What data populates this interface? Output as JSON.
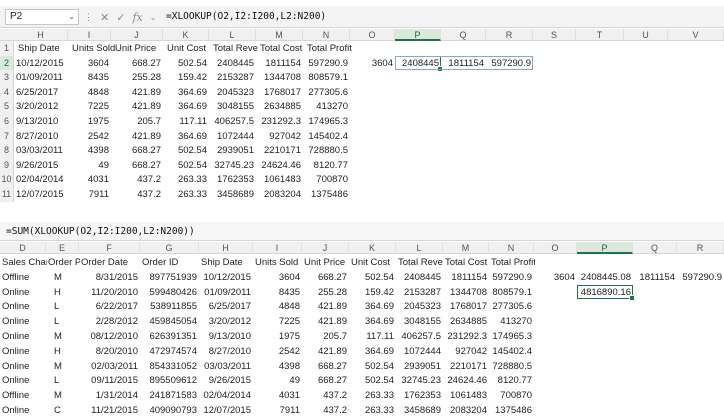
{
  "top": {
    "name_box": "P2",
    "formula": "=XLOOKUP(O2,I2:I200,L2:N200)",
    "columns": [
      "H",
      "I",
      "J",
      "K",
      "L",
      "M",
      "N",
      "O",
      "P",
      "Q",
      "R",
      "S",
      "T",
      "U",
      "V"
    ],
    "selected_column": "P",
    "row_numbers": [
      "1",
      "2",
      "3",
      "4",
      "5",
      "6",
      "7",
      "8",
      "9",
      "10",
      "11"
    ],
    "header_row": [
      "Ship Date",
      "Units Sold",
      "Unit Price",
      "Unit Cost",
      "Total Reve",
      "Total Cost",
      "Total Profit"
    ],
    "rows": [
      [
        "10/12/2015",
        "3604",
        "668.27",
        "502.54",
        "2408445",
        "1811154",
        "597290.9"
      ],
      [
        "01/09/2011",
        "8435",
        "255.28",
        "159.42",
        "2153287",
        "1344708",
        "808579.1"
      ],
      [
        "6/25/2017",
        "4848",
        "421.89",
        "364.69",
        "2045323",
        "1768017",
        "277305.6"
      ],
      [
        "3/20/2012",
        "7225",
        "421.89",
        "364.69",
        "3048155",
        "2634885",
        "413270"
      ],
      [
        "9/13/2010",
        "1975",
        "205.7",
        "117.11",
        "406257.5",
        "231292.3",
        "174965.3"
      ],
      [
        "8/27/2010",
        "2542",
        "421.89",
        "364.69",
        "1072444",
        "927042",
        "145402.4"
      ],
      [
        "03/03/2011",
        "4398",
        "668.27",
        "502.54",
        "2939051",
        "2210171",
        "728880.5"
      ],
      [
        "9/26/2015",
        "49",
        "668.27",
        "502.54",
        "32745.23",
        "24624.46",
        "8120.77"
      ],
      [
        "02/04/2014",
        "4031",
        "437.2",
        "263.33",
        "1762353",
        "1061483",
        "700870"
      ],
      [
        "12/07/2015",
        "7911",
        "437.2",
        "263.33",
        "3458689",
        "2083204",
        "1375486"
      ]
    ],
    "lookup": {
      "o": "3604",
      "p": "2408445",
      "q": "1811154",
      "r": "597290.9"
    }
  },
  "bottom": {
    "formula": "=SUM(XLOOKUP(O2,I2:I200,L2:N200))",
    "columns": [
      "D",
      "E",
      "F",
      "G",
      "H",
      "I",
      "J",
      "K",
      "L",
      "M",
      "N",
      "O",
      "P",
      "Q",
      "R"
    ],
    "selected_column": "P",
    "header_row": [
      "Sales Char",
      "Order Prio",
      "Order Date",
      "Order ID",
      "Ship Date",
      "Units Sold",
      "Unit Price",
      "Unit Cost",
      "Total Reve",
      "Total Cost",
      "Total Profit"
    ],
    "rows": [
      [
        "Offline",
        "M",
        "8/31/2015",
        "897751939",
        "10/12/2015",
        "3604",
        "668.27",
        "502.54",
        "2408445",
        "1811154",
        "597290.9"
      ],
      [
        "Online",
        "H",
        "11/20/2010",
        "599480426",
        "01/09/2011",
        "8435",
        "255.28",
        "159.42",
        "2153287",
        "1344708",
        "808579.1"
      ],
      [
        "Online",
        "L",
        "6/22/2017",
        "538911855",
        "6/25/2017",
        "4848",
        "421.89",
        "364.69",
        "2045323",
        "1768017",
        "277305.6"
      ],
      [
        "Online",
        "L",
        "2/28/2012",
        "459845054",
        "3/20/2012",
        "7225",
        "421.89",
        "364.69",
        "3048155",
        "2634885",
        "413270"
      ],
      [
        "Online",
        "M",
        "08/12/2010",
        "626391351",
        "9/13/2010",
        "1975",
        "205.7",
        "117.11",
        "406257.5",
        "231292.3",
        "174965.3"
      ],
      [
        "Online",
        "H",
        "8/20/2010",
        "472974574",
        "8/27/2010",
        "2542",
        "421.89",
        "364.69",
        "1072444",
        "927042",
        "145402.4"
      ],
      [
        "Online",
        "M",
        "02/03/2011",
        "854331052",
        "03/03/2011",
        "4398",
        "668.27",
        "502.54",
        "2939051",
        "2210171",
        "728880.5"
      ],
      [
        "Online",
        "L",
        "09/11/2015",
        "895509612",
        "9/26/2015",
        "49",
        "668.27",
        "502.54",
        "32745.23",
        "24624.46",
        "8120.77"
      ],
      [
        "Offline",
        "M",
        "1/31/2014",
        "241871583",
        "02/04/2014",
        "4031",
        "437.2",
        "263.33",
        "1762353",
        "1061483",
        "700870"
      ],
      [
        "Online",
        "C",
        "11/21/2015",
        "409090793",
        "12/07/2015",
        "7911",
        "437.2",
        "263.33",
        "3458689",
        "2083204",
        "1375486"
      ]
    ],
    "lookup": {
      "o": "3604",
      "p": "2408445.08",
      "q": "1811154",
      "r": "597290.9"
    },
    "sum_value": "4816890.16"
  }
}
